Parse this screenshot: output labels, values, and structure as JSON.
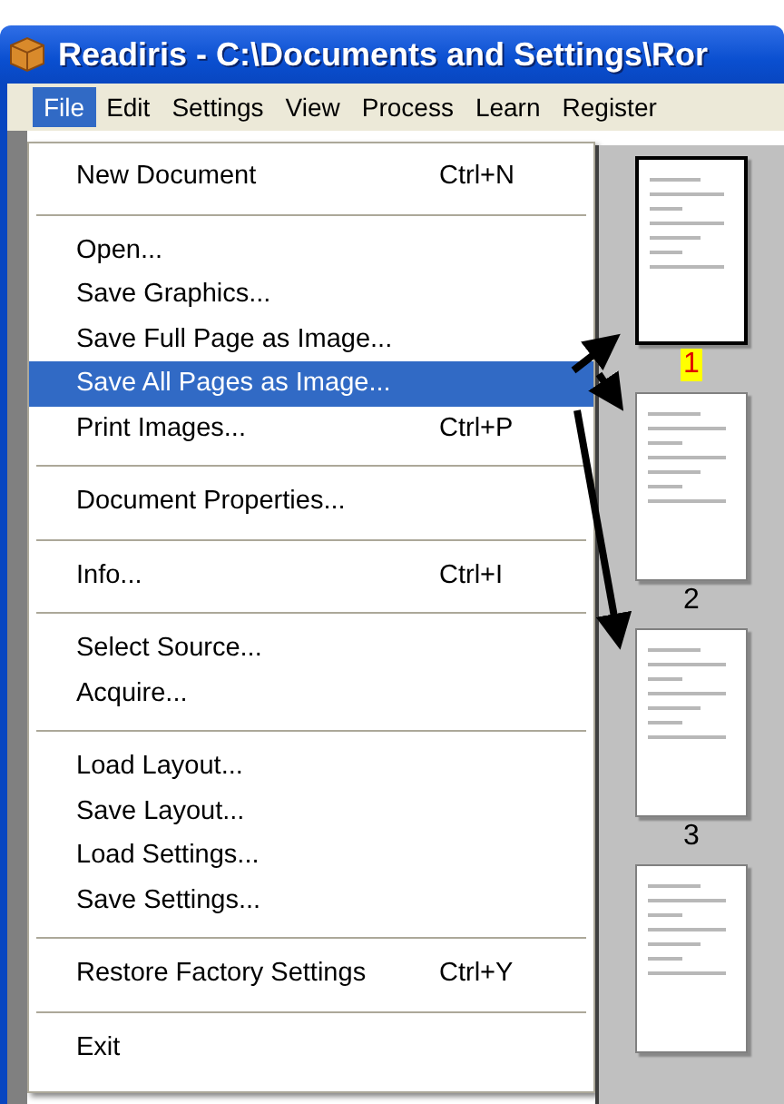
{
  "window": {
    "title": "Readiris - C:\\Documents and Settings\\Ror"
  },
  "menu_bar": [
    {
      "label": "File",
      "selected": true
    },
    {
      "label": "Edit",
      "selected": false
    },
    {
      "label": "Settings",
      "selected": false
    },
    {
      "label": "View",
      "selected": false
    },
    {
      "label": "Process",
      "selected": false
    },
    {
      "label": "Learn",
      "selected": false
    },
    {
      "label": "Register",
      "selected": false
    }
  ],
  "file_menu": {
    "items": [
      {
        "kind": "item",
        "label": "New Document",
        "shortcut": "Ctrl+N",
        "selected": false
      },
      {
        "kind": "separator"
      },
      {
        "kind": "item",
        "label": "Open...",
        "selected": false
      },
      {
        "kind": "item",
        "label": "Save Graphics...",
        "selected": false
      },
      {
        "kind": "item",
        "label": "Save Full Page as Image...",
        "selected": false
      },
      {
        "kind": "item",
        "label": "Save All Pages as Image...",
        "selected": true
      },
      {
        "kind": "item",
        "label": "Print Images...",
        "shortcut": "Ctrl+P",
        "selected": false
      },
      {
        "kind": "separator"
      },
      {
        "kind": "item",
        "label": "Document Properties...",
        "selected": false
      },
      {
        "kind": "separator"
      },
      {
        "kind": "item",
        "label": "Info...",
        "shortcut": "Ctrl+I",
        "selected": false
      },
      {
        "kind": "separator"
      },
      {
        "kind": "item",
        "label": "Select Source...",
        "selected": false
      },
      {
        "kind": "item",
        "label": "Acquire...",
        "selected": false
      },
      {
        "kind": "separator"
      },
      {
        "kind": "item",
        "label": "Load Layout...",
        "selected": false
      },
      {
        "kind": "item",
        "label": "Save Layout...",
        "selected": false
      },
      {
        "kind": "item",
        "label": "Load Settings...",
        "selected": false
      },
      {
        "kind": "item",
        "label": "Save Settings...",
        "selected": false
      },
      {
        "kind": "separator"
      },
      {
        "kind": "item",
        "label": "Restore Factory Settings",
        "shortcut": "Ctrl+Y",
        "selected": false
      },
      {
        "kind": "separator"
      },
      {
        "kind": "item",
        "label": "Exit",
        "selected": false
      }
    ]
  },
  "thumbnails": [
    {
      "label": "1",
      "selected": true
    },
    {
      "label": "2",
      "selected": false
    },
    {
      "label": "3",
      "selected": false
    },
    {
      "selected": false
    }
  ]
}
